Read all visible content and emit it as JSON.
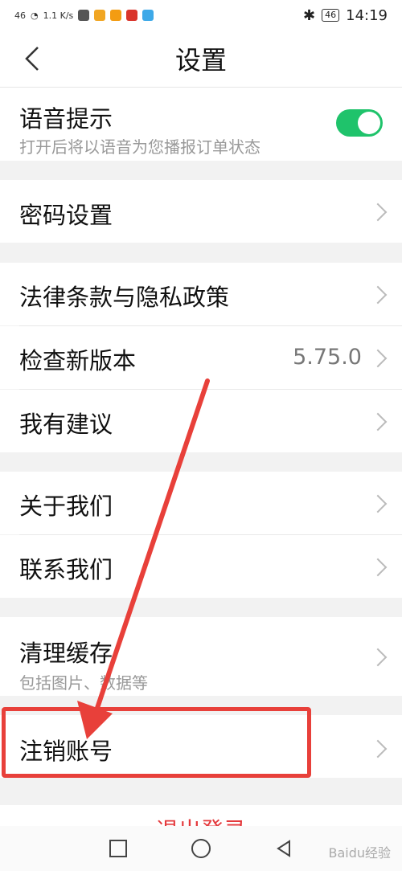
{
  "statusbar": {
    "signal": "46",
    "speed": "1.1\nK/s",
    "battery": "46",
    "time": "14:19"
  },
  "header": {
    "title": "设置",
    "back_icon": "chevron-left-icon"
  },
  "voice": {
    "label": "语音提示",
    "sub": "打开后将以语音为您播报订单状态",
    "enabled": true,
    "toggle_color": "#1fc36b"
  },
  "password": {
    "label": "密码设置"
  },
  "legal": {
    "label": "法律条款与隐私政策"
  },
  "update": {
    "label": "检查新版本",
    "version": "5.75.0"
  },
  "feedback": {
    "label": "我有建议"
  },
  "about": {
    "label": "关于我们"
  },
  "contact": {
    "label": "联系我们"
  },
  "cache": {
    "label": "清理缓存",
    "sub": "包括图片、数据等"
  },
  "cancel": {
    "label": "注销账号"
  },
  "logout": {
    "label": "退出登录"
  },
  "annotation_color": "#e8403a",
  "watermark": "Baidu经验"
}
